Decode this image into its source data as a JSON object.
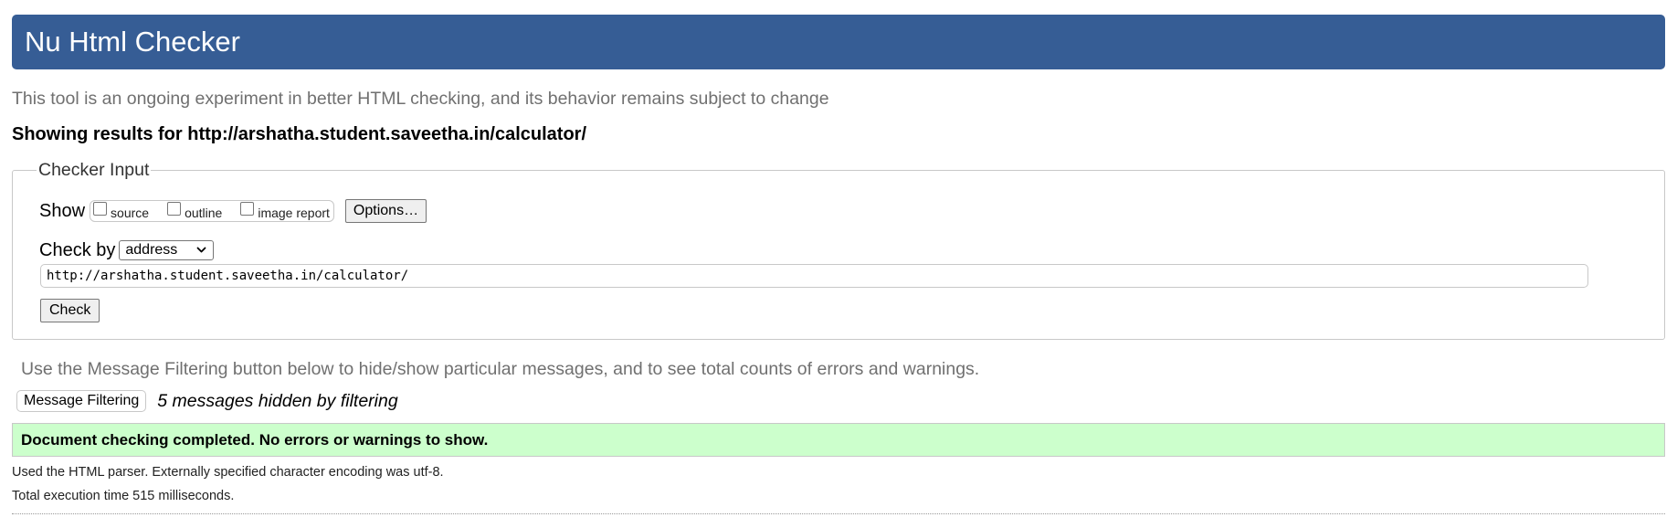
{
  "header": {
    "title": "Nu Html Checker"
  },
  "intro_text": "This tool is an ongoing experiment in better HTML checking, and its behavior remains subject to change",
  "results_heading": "Showing results for http://arshatha.student.saveetha.in/calculator/",
  "checker_input": {
    "legend": "Checker Input",
    "show_label": "Show",
    "show_options": [
      {
        "label": "source",
        "checked": false
      },
      {
        "label": "outline",
        "checked": false
      },
      {
        "label": "image report",
        "checked": false
      }
    ],
    "options_button": "Options…",
    "check_by_label": "Check by",
    "check_by_value": "address",
    "url_value": "http://arshatha.student.saveetha.in/calculator/",
    "check_button": "Check"
  },
  "filtering": {
    "note": "Use the Message Filtering button below to hide/show particular messages, and to see total counts of errors and warnings.",
    "button_label": "Message Filtering",
    "hidden_count_text": "5 messages hidden by filtering"
  },
  "result": {
    "message": "Document checking completed. No errors or warnings to show.",
    "status_color": "#ccffcc",
    "parser_info": "Used the HTML parser. Externally specified character encoding was utf-8.",
    "execution_time": "Total execution time 515 milliseconds."
  },
  "colors": {
    "banner": "#365d95",
    "muted_text": "#707070"
  }
}
